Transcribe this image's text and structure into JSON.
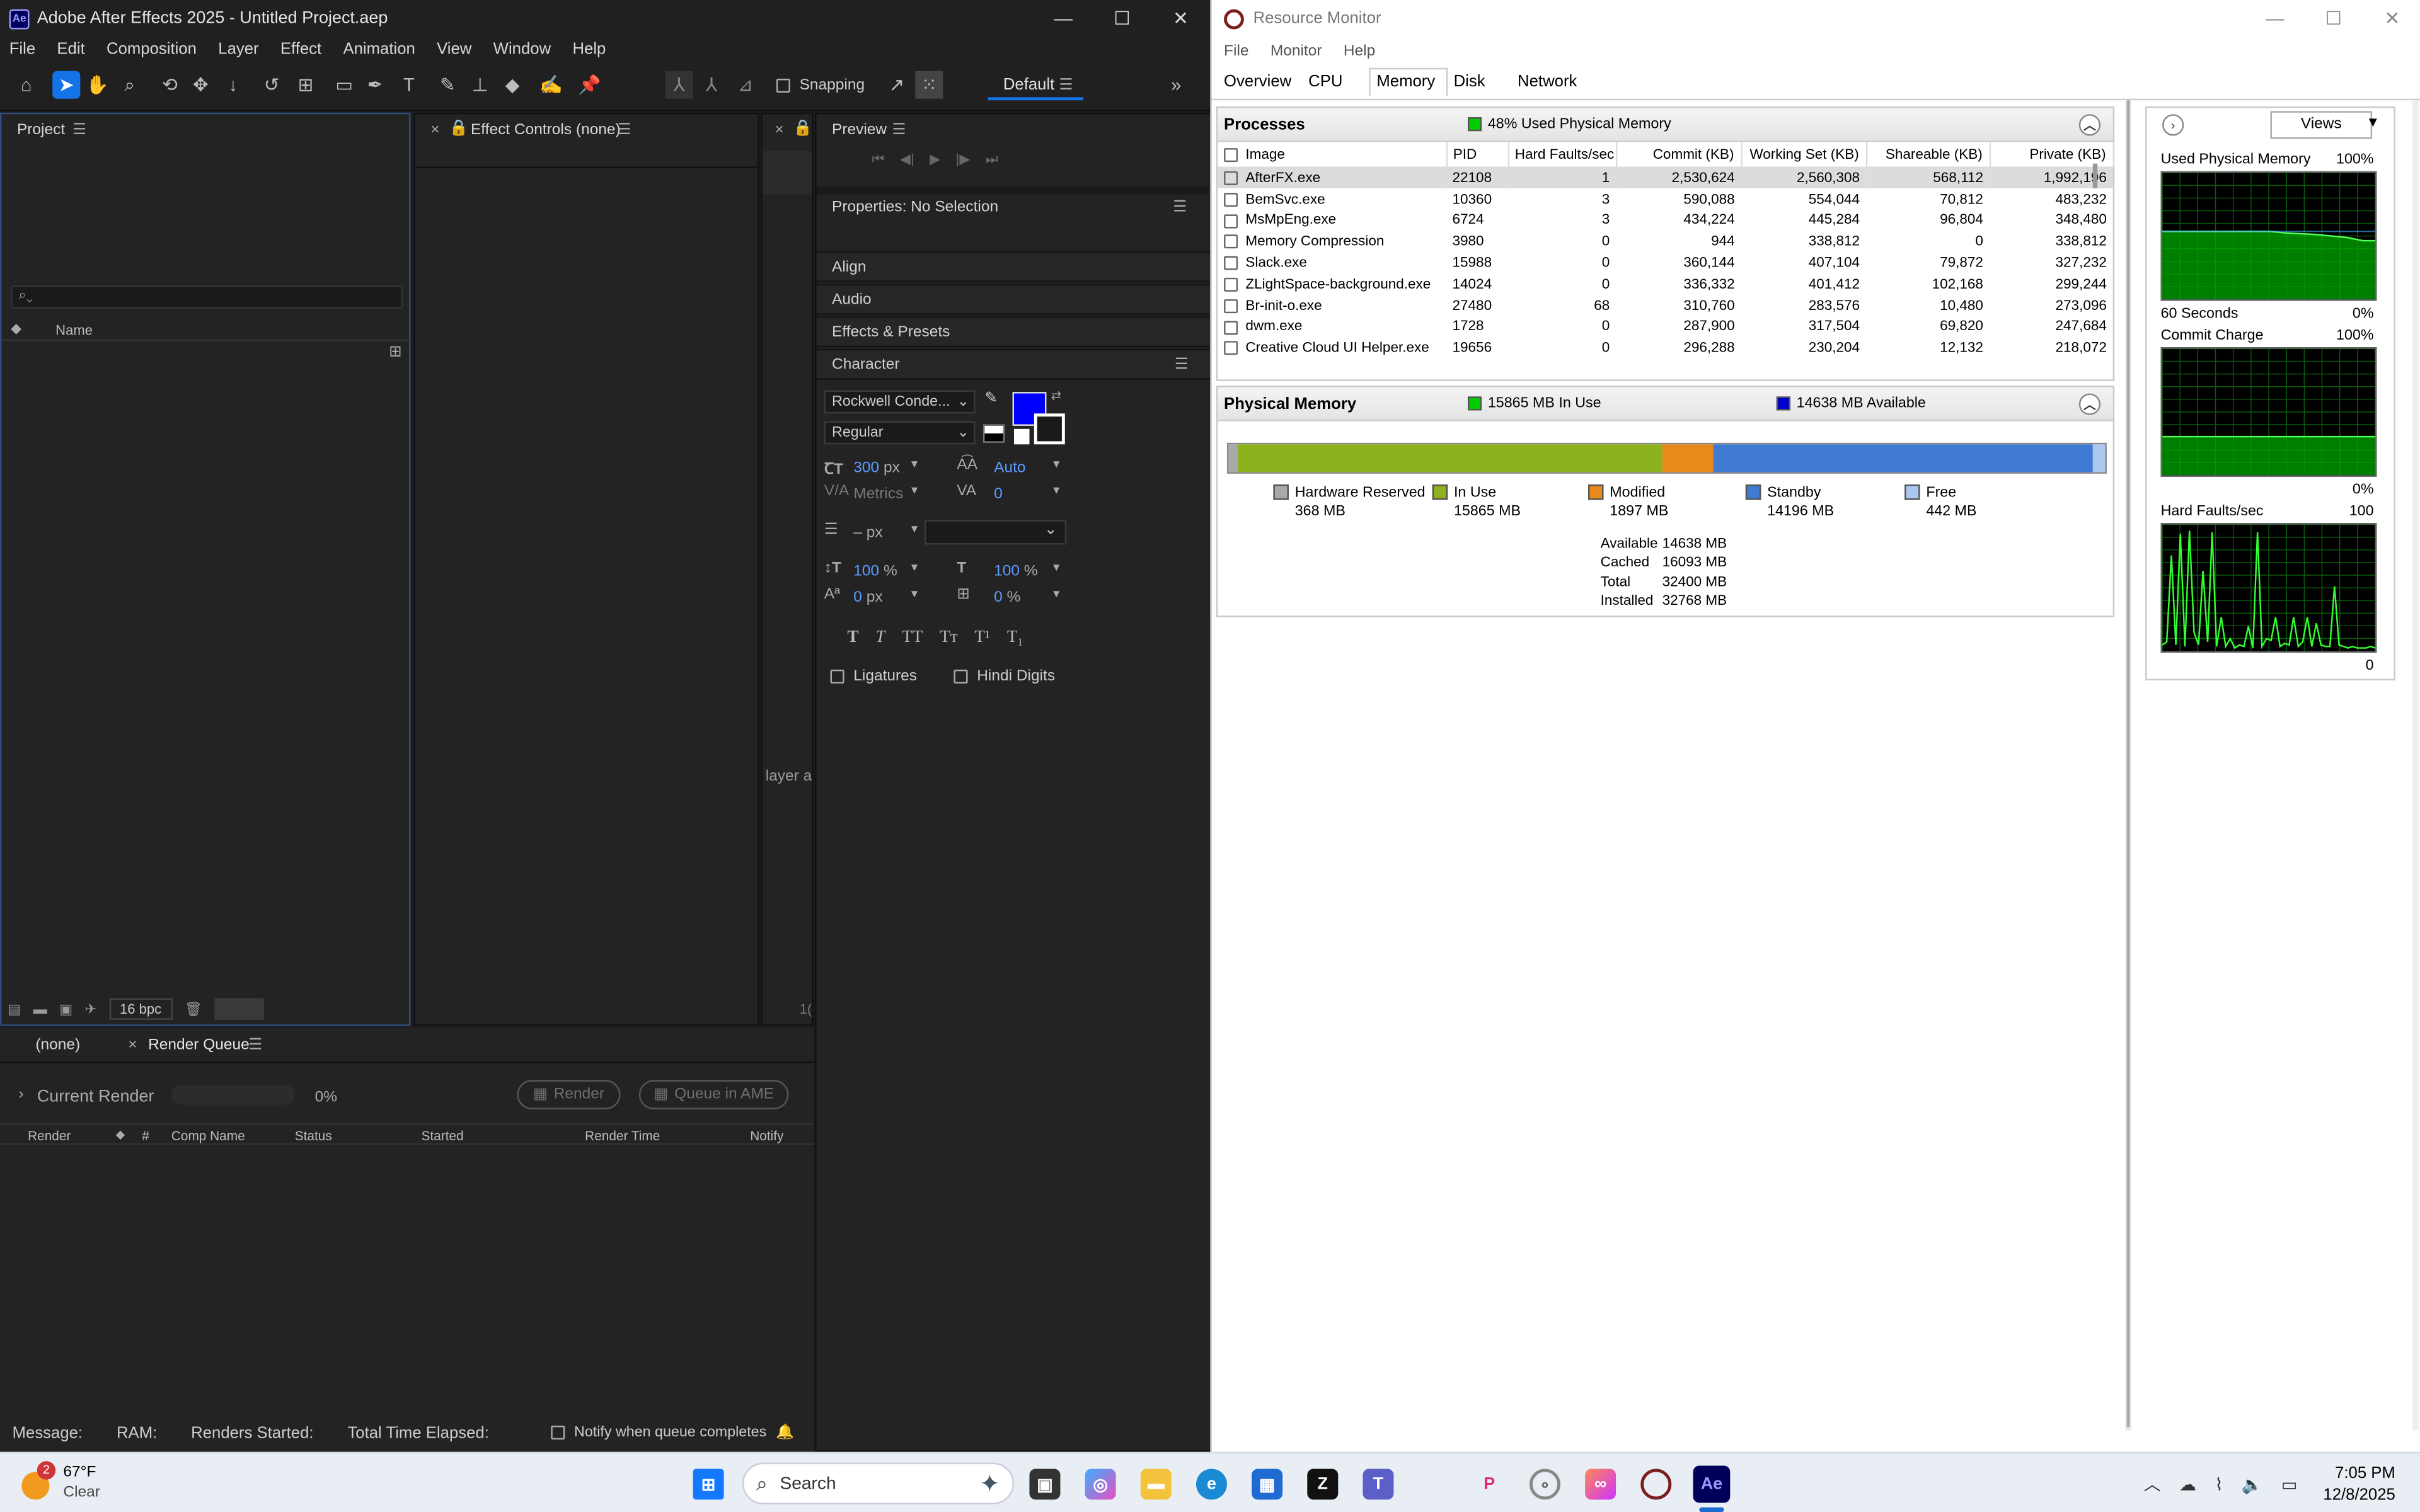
{
  "ae": {
    "title": "Adobe After Effects 2025 - Untitled Project.aep",
    "logo": "Ae",
    "menu": [
      "File",
      "Edit",
      "Composition",
      "Layer",
      "Effect",
      "Animation",
      "View",
      "Window",
      "Help"
    ],
    "snapping_label": "Snapping",
    "workspace": "Default",
    "project": {
      "tab": "Project",
      "search_placeholder": "",
      "col_name": "Name",
      "bpc": "16 bpc"
    },
    "effect_controls": {
      "tab": "Effect Controls (none)"
    },
    "comp": {
      "partial_label": "layer a",
      "number": "1("
    },
    "preview": {
      "tab": "Preview"
    },
    "properties": {
      "tab": "Properties: No Selection"
    },
    "sections": {
      "align": "Align",
      "audio": "Audio",
      "effects_presets": "Effects & Presets",
      "character": "Character"
    },
    "character": {
      "font": "Rockwell Conde...",
      "style": "Regular",
      "size": "300",
      "size_unit": "px",
      "leading": "Auto",
      "kerning": "Metrics",
      "tracking": "0",
      "stroke_width": "–",
      "stroke_unit": "px",
      "vscale": "100",
      "hscale": "100",
      "percent": "%",
      "baseline": "0",
      "baseline_unit": "px",
      "tsume": "0",
      "tsume_unit": "%",
      "fill_color": "#0000ff",
      "ligatures": "Ligatures",
      "hindi_digits": "Hindi Digits",
      "style_buttons": [
        "T",
        "T",
        "TT",
        "Tт",
        "T¹",
        "T₁"
      ]
    },
    "bottom_tabs": {
      "none": "(none)",
      "render_queue": "Render Queue"
    },
    "render": {
      "current_render": "Current Render",
      "progress_pct": "0%",
      "render_btn": "Render",
      "queue_btn": "Queue in AME",
      "columns": [
        "Render",
        "#",
        "Comp Name",
        "Status",
        "Started",
        "Render Time",
        "Notify"
      ]
    },
    "status": {
      "message": "Message:",
      "ram": "RAM:",
      "renders_started": "Renders Started:",
      "total_time": "Total Time Elapsed:",
      "notify": "Notify when queue completes"
    }
  },
  "rm": {
    "title": "Resource Monitor",
    "menu": [
      "File",
      "Monitor",
      "Help"
    ],
    "tabs": [
      "Overview",
      "CPU",
      "Memory",
      "Disk",
      "Network"
    ],
    "active_tab": "Memory",
    "processes": {
      "title": "Processes",
      "badge": "48% Used Physical Memory",
      "columns": [
        "Image",
        "PID",
        "Hard Faults/sec",
        "Commit (KB)",
        "Working Set (KB)",
        "Shareable (KB)",
        "Private (KB)"
      ],
      "rows": [
        [
          "AfterFX.exe",
          "22108",
          "1",
          "2,530,624",
          "2,560,308",
          "568,112",
          "1,992,196"
        ],
        [
          "BemSvc.exe",
          "10360",
          "3",
          "590,088",
          "554,044",
          "70,812",
          "483,232"
        ],
        [
          "MsMpEng.exe",
          "6724",
          "3",
          "434,224",
          "445,284",
          "96,804",
          "348,480"
        ],
        [
          "Memory Compression",
          "3980",
          "0",
          "944",
          "338,812",
          "0",
          "338,812"
        ],
        [
          "Slack.exe",
          "15988",
          "0",
          "360,144",
          "407,104",
          "79,872",
          "327,232"
        ],
        [
          "ZLightSpace-background.exe",
          "14024",
          "0",
          "336,332",
          "401,412",
          "102,168",
          "299,244"
        ],
        [
          "Br-init-o.exe",
          "27480",
          "68",
          "310,760",
          "283,576",
          "10,480",
          "273,096"
        ],
        [
          "dwm.exe",
          "1728",
          "0",
          "287,900",
          "317,504",
          "69,820",
          "247,684"
        ],
        [
          "Creative Cloud UI Helper.exe",
          "19656",
          "0",
          "296,288",
          "230,204",
          "12,132",
          "218,072"
        ]
      ]
    },
    "physical": {
      "title": "Physical Memory",
      "in_use_badge": "15865 MB In Use",
      "available_badge": "14638 MB Available",
      "legend": [
        {
          "label": "Hardware Reserved",
          "value": "368 MB",
          "color": "#a9a9a9"
        },
        {
          "label": "In Use",
          "value": "15865 MB",
          "color": "#8cb31f"
        },
        {
          "label": "Modified",
          "value": "1897 MB",
          "color": "#e8891c"
        },
        {
          "label": "Standby",
          "value": "14196 MB",
          "color": "#3e7bd1"
        },
        {
          "label": "Free",
          "value": "442 MB",
          "color": "#aac8ef"
        }
      ],
      "segments_mb": [
        368,
        15865,
        1897,
        14196,
        442
      ],
      "stats": [
        [
          "Available",
          "14638 MB"
        ],
        [
          "Cached",
          "16093 MB"
        ],
        [
          "Total",
          "32400 MB"
        ],
        [
          "Installed",
          "32768 MB"
        ]
      ]
    },
    "graphs": {
      "views_label": "Views",
      "used_physical": {
        "title": "Used Physical Memory",
        "max": "100%",
        "min": "0%",
        "time": "60 Seconds"
      },
      "commit_charge": {
        "title": "Commit Charge",
        "max": "100%",
        "min": "0%"
      },
      "hard_faults": {
        "title": "Hard Faults/sec",
        "max": "100",
        "min": "0"
      }
    }
  },
  "taskbar": {
    "weather_temp": "67°F",
    "weather_cond": "Clear",
    "weather_badge": "2",
    "search": "Search",
    "time": "7:05 PM",
    "date": "12/8/2025"
  }
}
